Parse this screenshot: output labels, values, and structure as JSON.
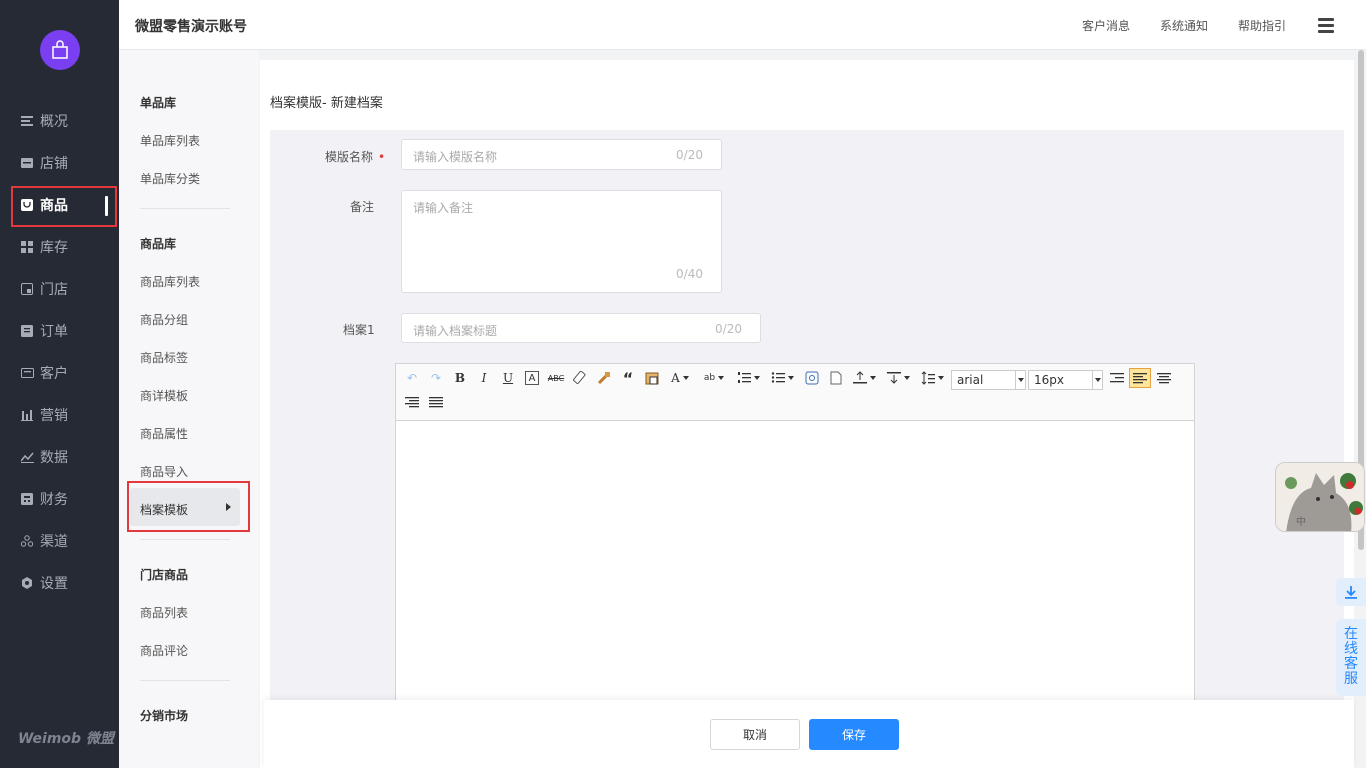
{
  "nav": {
    "items": [
      {
        "label": "概况",
        "icon": "overview-icon"
      },
      {
        "label": "店铺",
        "icon": "shop-icon"
      },
      {
        "label": "商品",
        "icon": "product-icon",
        "active": true
      },
      {
        "label": "库存",
        "icon": "inventory-icon"
      },
      {
        "label": "门店",
        "icon": "store-icon"
      },
      {
        "label": "订单",
        "icon": "order-icon"
      },
      {
        "label": "客户",
        "icon": "customer-icon"
      },
      {
        "label": "营销",
        "icon": "marketing-icon"
      },
      {
        "label": "数据",
        "icon": "data-icon"
      },
      {
        "label": "财务",
        "icon": "finance-icon"
      },
      {
        "label": "渠道",
        "icon": "channel-icon"
      },
      {
        "label": "设置",
        "icon": "settings-icon"
      }
    ],
    "logo": "Weimob 微盟",
    "accent": "#7b3ff2"
  },
  "header": {
    "shop_name": "微盟零售演示账号",
    "links": [
      "客户消息",
      "系统通知",
      "帮助指引"
    ]
  },
  "subnav": {
    "group1": {
      "title": "单品库",
      "items": [
        "单品库列表",
        "单品库分类"
      ]
    },
    "group2": {
      "title": "商品库",
      "items": [
        "商品库列表",
        "商品分组",
        "商品标签",
        "商详模板",
        "商品属性",
        "商品导入",
        "档案模板"
      ]
    },
    "group3": {
      "title": "门店商品",
      "items": [
        "商品列表",
        "商品评论"
      ]
    },
    "group4": {
      "title": "分销市场"
    }
  },
  "page": {
    "title": "档案模版- 新建档案",
    "template_name": {
      "label": "模版名称",
      "required_mark": "•",
      "placeholder": "请输入模版名称",
      "count": "0/20"
    },
    "remark": {
      "label": "备注",
      "placeholder": "请输入备注",
      "count": "0/40"
    },
    "archive1": {
      "label": "档案1",
      "placeholder": "请输入档案标题",
      "count": "0/20"
    }
  },
  "editor": {
    "font_family": "arial",
    "font_size": "16px"
  },
  "footer": {
    "cancel": "取消",
    "save": "保存"
  },
  "side": {
    "service_chars": [
      "在",
      "线",
      "客",
      "服"
    ],
    "float_badge": "中"
  },
  "colors": {
    "primary": "#2589ff",
    "highlight_border": "#e4393c",
    "nav_bg": "#262a34"
  }
}
